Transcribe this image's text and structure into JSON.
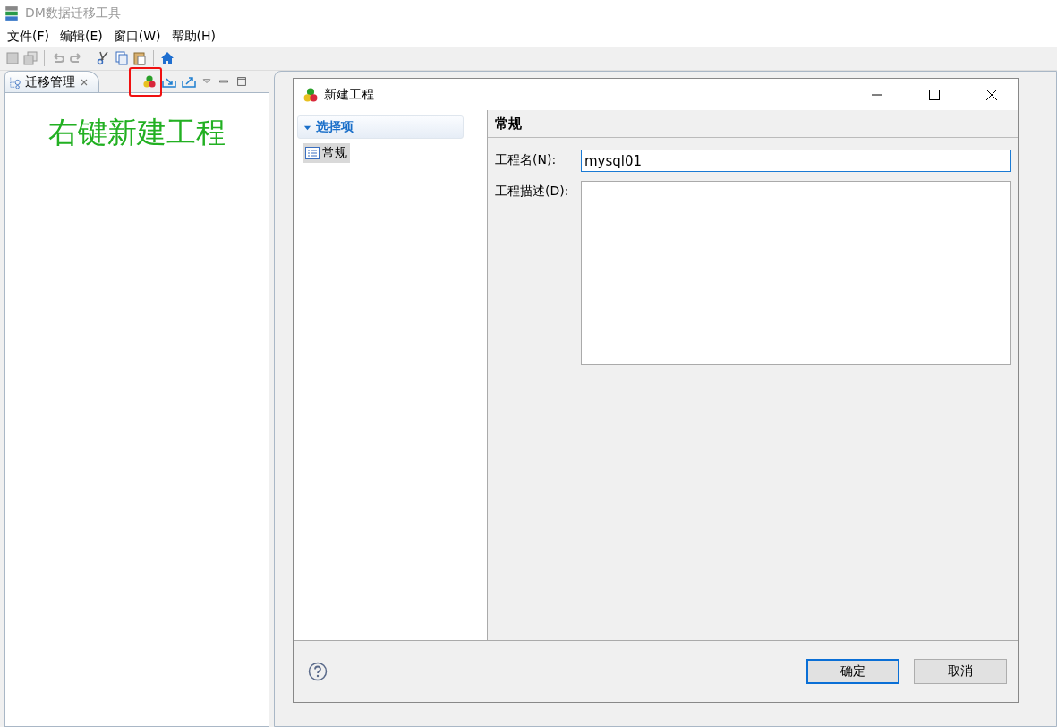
{
  "window": {
    "title": "DM数据迁移工具"
  },
  "menu": [
    "文件(F)",
    "编辑(E)",
    "窗口(W)",
    "帮助(H)"
  ],
  "panel": {
    "tab": "迁移管理",
    "hint": "右键新建工程"
  },
  "dialog": {
    "title": "新建工程",
    "tree": {
      "label": "选择项",
      "expanded": true,
      "children": [
        {
          "label": "常规",
          "selected": true
        }
      ]
    },
    "heading": "常规",
    "fields": [
      {
        "kind": "text",
        "label": "工程名(N):",
        "value": "mysql01"
      },
      {
        "kind": "textarea",
        "label": "工程描述(D):"
      }
    ],
    "buttons": [
      {
        "label": "确定",
        "default": true
      },
      {
        "label": "取消",
        "default": false
      }
    ]
  }
}
